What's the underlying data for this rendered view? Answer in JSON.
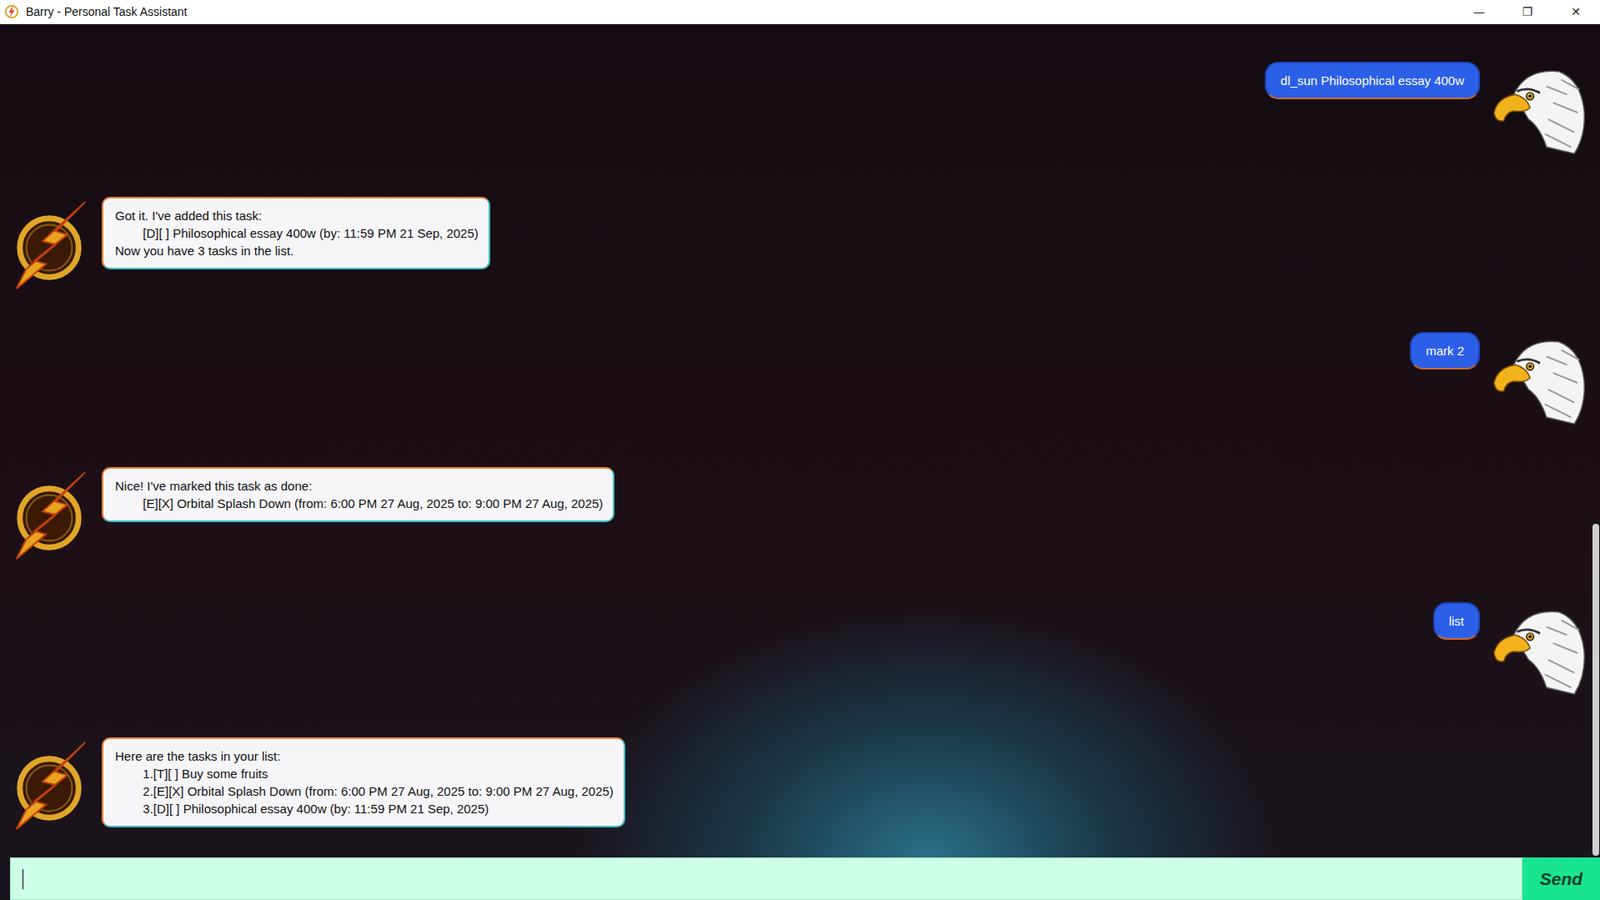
{
  "window": {
    "title": "Barry - Personal Task Assistant",
    "controls": [
      "—",
      "❐",
      "✕"
    ]
  },
  "messages": [
    {
      "kind": "user",
      "text": "dl_sun Philosophical essay 400w"
    },
    {
      "kind": "bot",
      "text": "Got it. I've added this task:\n\t[D][ ] Philosophical essay 400w (by: 11:59 PM 21 Sep, 2025)\nNow you have 3 tasks in the list."
    },
    {
      "kind": "user",
      "text": "mark 2"
    },
    {
      "kind": "bot",
      "text": "Nice! I've marked this task as done:\n\t[E][X] Orbital Splash Down (from: 6:00 PM 27 Aug, 2025 to: 9:00 PM 27 Aug, 2025)"
    },
    {
      "kind": "user",
      "text": "list"
    },
    {
      "kind": "bot",
      "text": "Here are the tasks in your list:\n\t1.[T][ ] Buy some fruits\n\t2.[E][X] Orbital Splash Down (from: 6:00 PM 27 Aug, 2025 to: 9:00 PM 27 Aug, 2025)\n\t3.[D][ ] Philosophical essay 400w (by: 11:59 PM 21 Sep, 2025)"
    }
  ],
  "scrollbar": {
    "level": 0.4
  },
  "input": {
    "value": ""
  },
  "send_button": {
    "label": "Send"
  }
}
